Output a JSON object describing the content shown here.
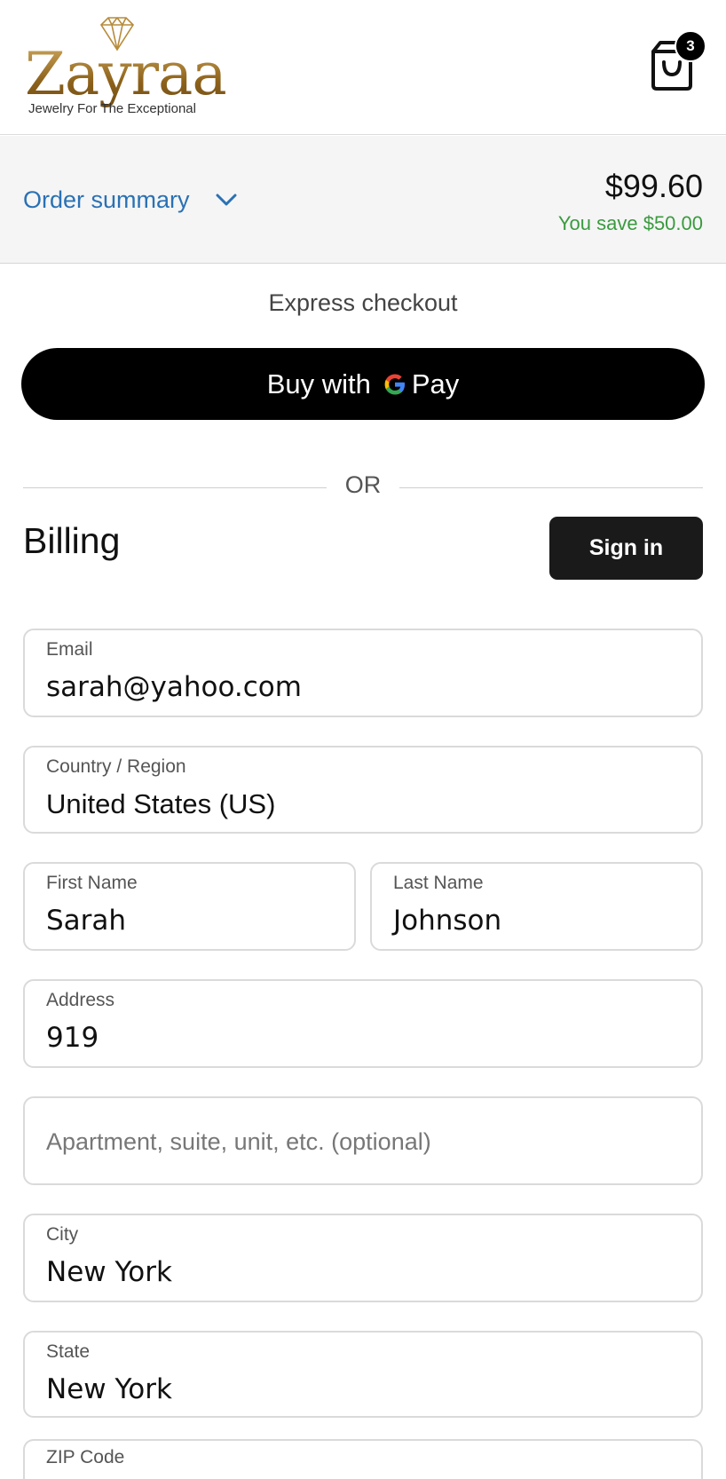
{
  "header": {
    "logo_name": "Zayraa",
    "logo_tagline": "Jewelry For The Exceptional",
    "cart_count": "3"
  },
  "summary": {
    "toggle_label": "Order summary",
    "total": "$99.60",
    "savings": "You save $50.00"
  },
  "express": {
    "title": "Express checkout",
    "gpay_prefix": "Buy with",
    "gpay_suffix": "Pay"
  },
  "divider": {
    "or": "OR"
  },
  "billing": {
    "title": "Billing",
    "signin_label": "Sign in",
    "fields": {
      "email": {
        "label": "Email",
        "value": "sarah@yahoo.com"
      },
      "country": {
        "label": "Country / Region",
        "value": "United States (US)"
      },
      "first_name": {
        "label": "First Name",
        "value": "Sarah"
      },
      "last_name": {
        "label": "Last Name",
        "value": "Johnson"
      },
      "address": {
        "label": "Address",
        "value": "919"
      },
      "apartment": {
        "placeholder": "Apartment, suite, unit, etc. (optional)"
      },
      "city": {
        "label": "City",
        "value": "New York"
      },
      "state": {
        "label": "State",
        "value": "New York"
      },
      "zip": {
        "label": "ZIP Code"
      }
    }
  },
  "colors": {
    "link_blue": "#2a71b4",
    "savings_green": "#3a9a3f",
    "logo_gold": "#9c7424"
  }
}
